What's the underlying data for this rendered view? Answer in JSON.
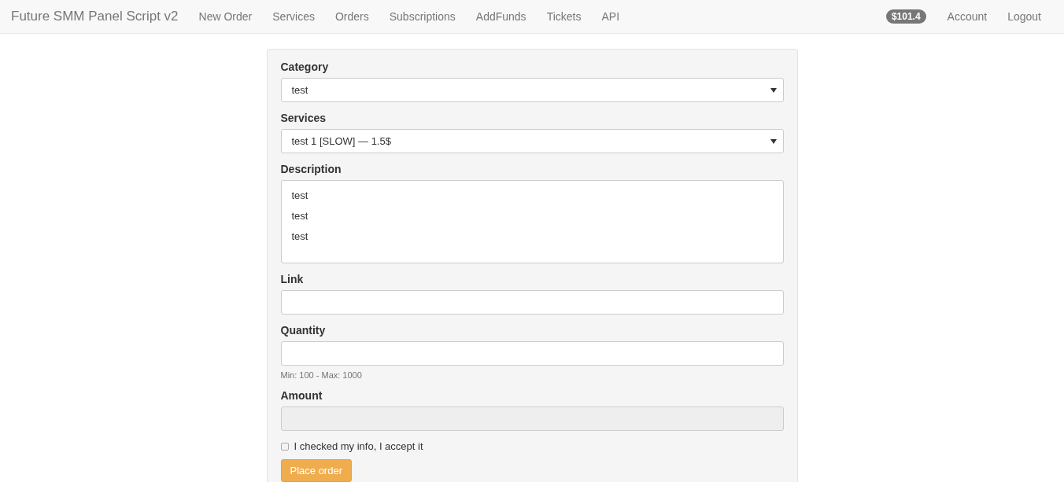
{
  "navbar": {
    "brand": "Future SMM Panel Script v2",
    "links": [
      {
        "label": "New Order"
      },
      {
        "label": "Services"
      },
      {
        "label": "Orders"
      },
      {
        "label": "Subscriptions"
      },
      {
        "label": "AddFunds"
      },
      {
        "label": "Tickets"
      },
      {
        "label": "API"
      }
    ],
    "balance": "$101.4",
    "right_links": [
      {
        "label": "Account"
      },
      {
        "label": "Logout"
      }
    ]
  },
  "form": {
    "fields": [
      {
        "kind": "select",
        "label": "Category",
        "value": "test"
      },
      {
        "kind": "select",
        "label": "Services",
        "value": "test 1 [SLOW] — 1.5$"
      },
      {
        "kind": "textarea",
        "label": "Description",
        "lines": [
          "test",
          "test",
          "test"
        ]
      },
      {
        "kind": "input",
        "label": "Link"
      },
      {
        "kind": "input",
        "label": "Quantity",
        "help": "Min: 100 - Max: 1000"
      },
      {
        "kind": "readonly",
        "label": "Amount"
      }
    ],
    "checkbox": {
      "label": "I checked my info, I accept it",
      "checked": false
    },
    "submit": "Place order"
  }
}
